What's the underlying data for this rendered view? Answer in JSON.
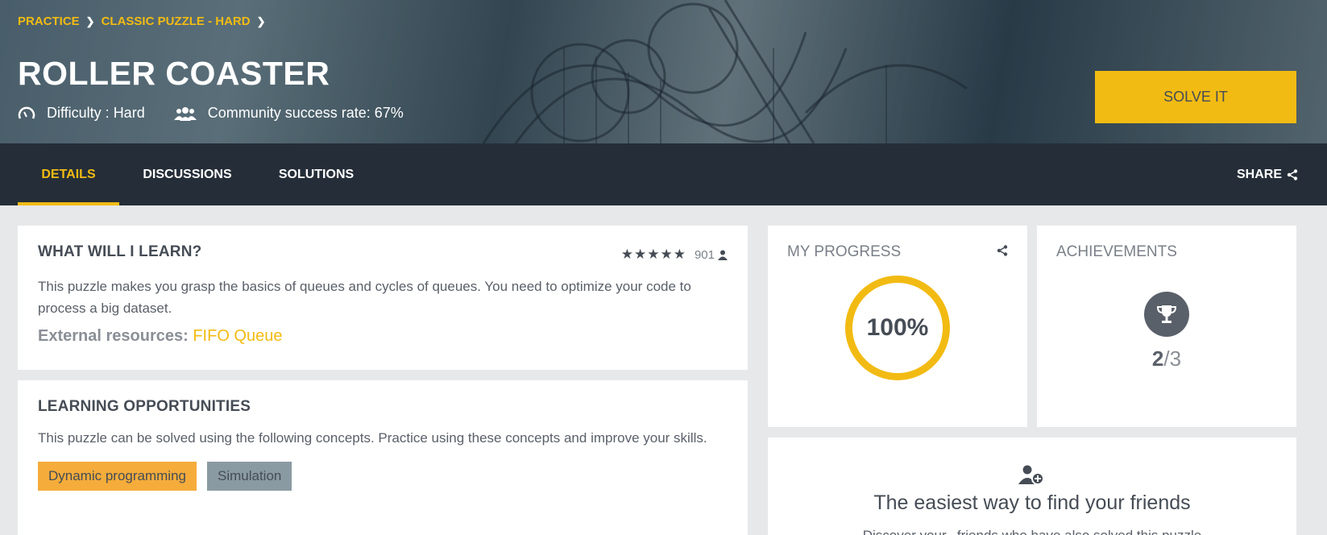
{
  "breadcrumb": {
    "items": [
      "PRACTICE",
      "CLASSIC PUZZLE - HARD"
    ],
    "separator": ">"
  },
  "puzzle": {
    "title": "ROLLER COASTER",
    "difficulty": "Difficulty : Hard",
    "success_rate": "Community success rate: 67%",
    "solve_button": "SOLVE IT"
  },
  "tabs": [
    {
      "label": "DETAILS",
      "active": true
    },
    {
      "label": "DISCUSSIONS",
      "active": false
    },
    {
      "label": "SOLUTIONS",
      "active": false
    }
  ],
  "share_label": "SHARE",
  "learn": {
    "heading": "WHAT WILL I LEARN?",
    "rating_count": "901",
    "description": "This puzzle makes you grasp the basics of queues and cycles of queues. You need to optimize your code to process a big dataset.",
    "resources_label": "External resources:",
    "resource_link": "FIFO Queue"
  },
  "opportunities": {
    "heading": "LEARNING OPPORTUNITIES",
    "description": "This puzzle can be solved using the following concepts. Practice using these concepts and improve your skills.",
    "tags": [
      "Dynamic programming",
      "Simulation"
    ]
  },
  "progress": {
    "label": "MY PROGRESS",
    "value": "100%"
  },
  "achievements": {
    "label": "ACHIEVEMENTS",
    "earned": "2",
    "total": "/3"
  },
  "friends": {
    "heading": "The easiest way to find your friends",
    "subtext": "Discover your...friends who have also solved this puzzle"
  },
  "colors": {
    "accent": "#f2bb13",
    "navbar": "#252e38",
    "tag_orange": "#f5ac3b",
    "tag_grey": "#8a9aa3"
  },
  "icons": [
    "chevron-right-icon",
    "gauge-icon",
    "users-icon",
    "share-icon",
    "star-icon",
    "user-icon",
    "trophy-icon",
    "add-user-icon"
  ]
}
